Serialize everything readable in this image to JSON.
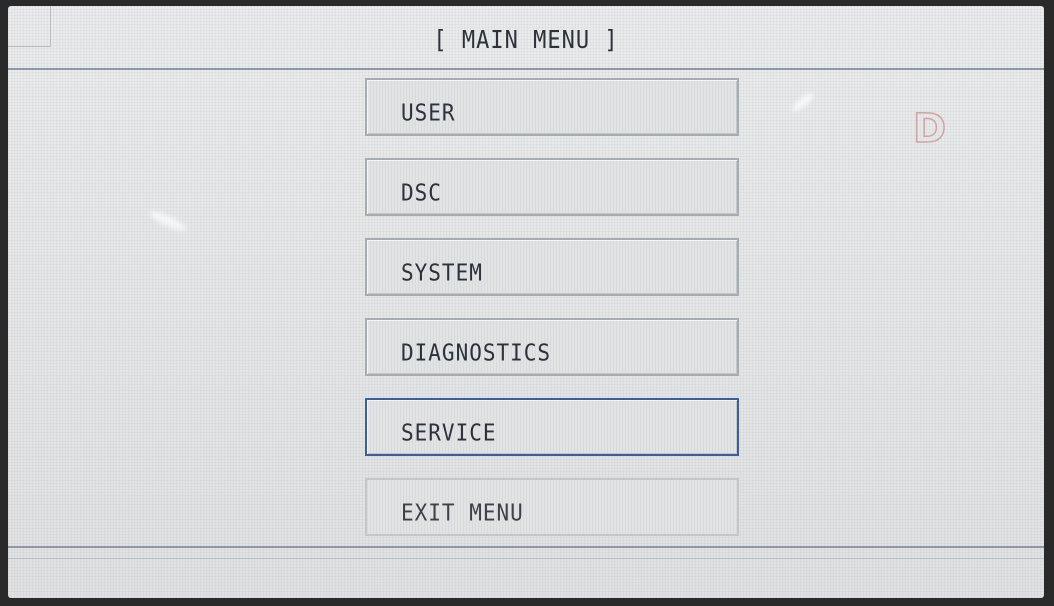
{
  "header": {
    "title": "[ MAIN MENU ]"
  },
  "menu": {
    "items": [
      {
        "label": "USER"
      },
      {
        "label": "DSC"
      },
      {
        "label": "SYSTEM"
      },
      {
        "label": "DIAGNOSTICS"
      },
      {
        "label": "SERVICE",
        "state": "selected"
      },
      {
        "label": "EXIT MENU"
      }
    ]
  },
  "status": {
    "indicator": "D"
  },
  "colors": {
    "background": "#e6e8e9",
    "text": "#2d3138",
    "selected_border": "#3c5e9e",
    "indicator": "#cfa4a4"
  }
}
